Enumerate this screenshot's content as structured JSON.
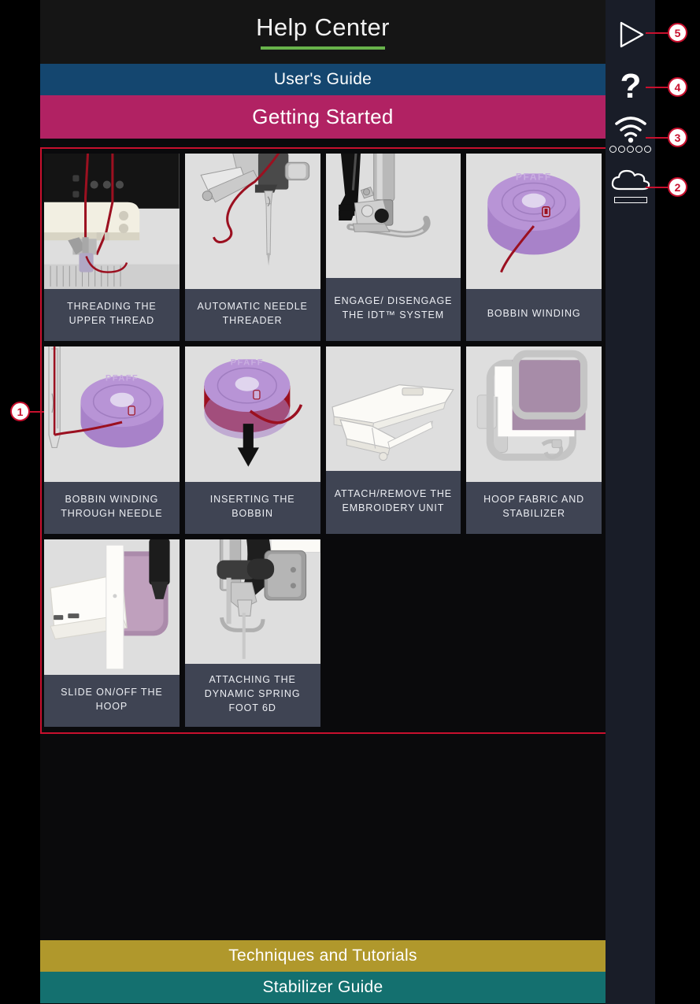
{
  "header": {
    "title": "Help Center",
    "underline_color": "#68b34b"
  },
  "nav_bars": {
    "users_guide": {
      "label": "User's Guide",
      "color": "#14466f"
    },
    "getting_started": {
      "label": "Getting Started",
      "color": "#b12263"
    },
    "techniques": {
      "label": "Techniques and Tutorials",
      "color": "#b0982c"
    },
    "stabilizer": {
      "label": "Stabilizer Guide",
      "color": "#14706f"
    }
  },
  "grid": {
    "tiles": [
      {
        "label": "THREADING THE UPPER THREAD",
        "image": "threading-upper-thread-illustration"
      },
      {
        "label": "AUTOMATIC NEEDLE THREADER",
        "image": "automatic-needle-threader-illustration"
      },
      {
        "label": "ENGAGE/ DISENGAGE THE IDT™ SYSTEM",
        "image": "idt-system-illustration"
      },
      {
        "label": "BOBBIN WINDING",
        "image": "bobbin-winding-illustration"
      },
      {
        "label": "BOBBIN WINDING THROUGH NEEDLE",
        "image": "bobbin-winding-through-needle-illustration"
      },
      {
        "label": "INSERTING THE BOBBIN",
        "image": "inserting-bobbin-illustration"
      },
      {
        "label": "ATTACH/REMOVE THE EMBROIDERY UNIT",
        "image": "embroidery-unit-illustration"
      },
      {
        "label": "HOOP FABRIC AND STABILIZER",
        "image": "hoop-fabric-stabilizer-illustration"
      },
      {
        "label": "SLIDE ON/OFF THE HOOP",
        "image": "slide-hoop-illustration"
      },
      {
        "label": "ATTACHING THE DYNAMIC SPRING FOOT 6D",
        "image": "dynamic-spring-foot-illustration"
      }
    ],
    "bobbin_brand_text": "PFAFF"
  },
  "sidebar": {
    "items": [
      {
        "name": "play-icon",
        "callout": "5"
      },
      {
        "name": "question-mark-icon",
        "callout": "4"
      },
      {
        "name": "wifi-icon",
        "callout": "3",
        "dots": 5
      },
      {
        "name": "cloud-icon",
        "callout": "2"
      }
    ]
  },
  "annotations": {
    "grid_callout": "1",
    "accent_color": "#c8102e"
  }
}
